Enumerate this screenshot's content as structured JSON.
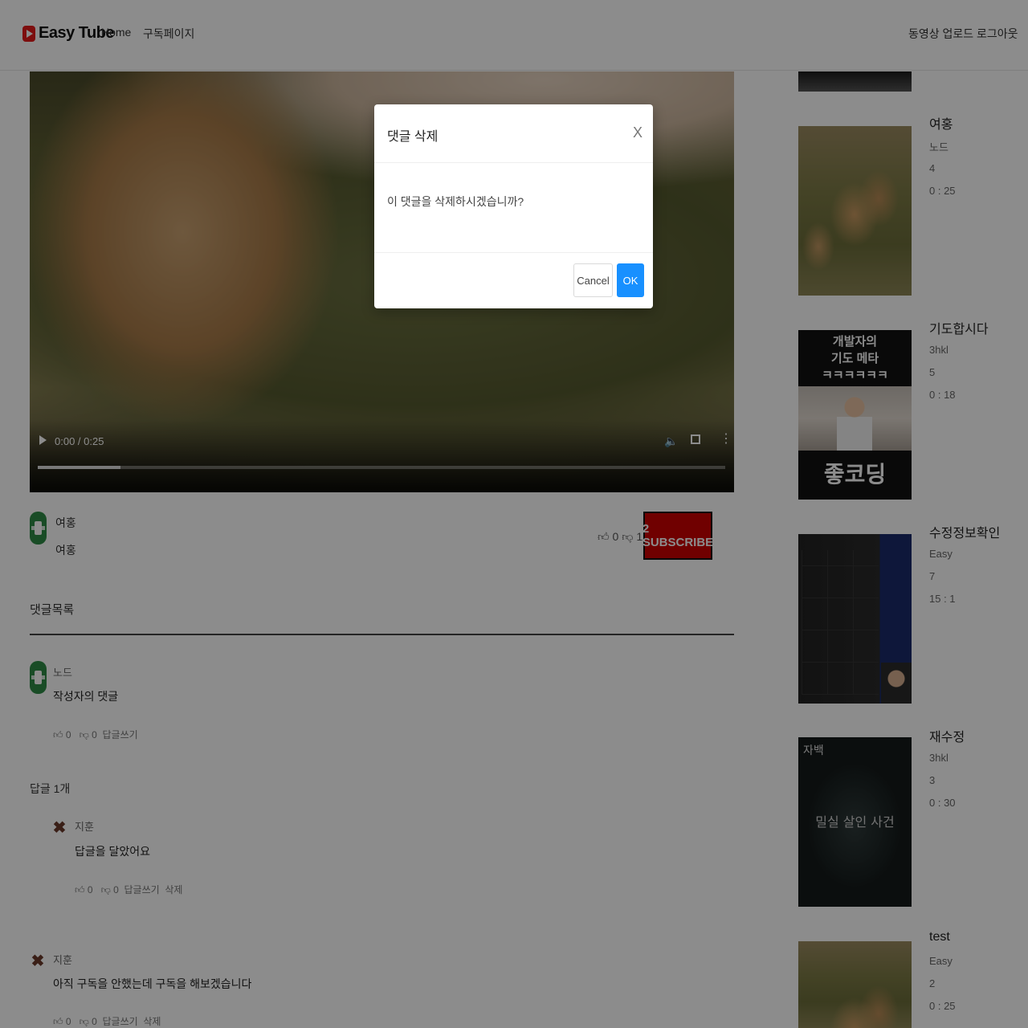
{
  "header": {
    "logo_text": "Easy Tube",
    "nav": {
      "home": "Home",
      "subscriptions": "구독페이지",
      "upload": "동영상 업로드",
      "logout": "로그아웃"
    }
  },
  "player": {
    "time": "0:00 / 0:25",
    "progress_fraction": 0.12
  },
  "video_info": {
    "owner": "여홍",
    "description": "여홍",
    "likes": "0",
    "dislikes": "1",
    "subscribe_label": "2 SUBSCRIBE"
  },
  "comments": {
    "title": "댓글목록",
    "items": [
      {
        "author": "노드",
        "text": "작성자의 댓글",
        "likes": "0",
        "dislikes": "0",
        "reply": "답글쓰기"
      }
    ],
    "reply_count": "답글 1개",
    "replies": [
      {
        "author": "지훈",
        "text": "답글을 달았어요",
        "likes": "0",
        "dislikes": "0",
        "reply": "답글쓰기",
        "delete": "삭제"
      },
      {
        "author": "지훈",
        "text": "아직 구독을 안했는데 구독을 해보겠습니다",
        "likes": "0",
        "dislikes": "0",
        "reply": "답글쓰기",
        "delete": "삭제"
      }
    ]
  },
  "sidebar": {
    "videos": [
      {
        "title": "여홍",
        "author": "노드",
        "views": "4",
        "duration": "0 : 25"
      },
      {
        "title": "기도합시다",
        "author": "3hkl",
        "views": "5",
        "duration": "0 : 18",
        "thumb_title": "개발자의\n기도 메타\nㅋㅋㅋㅋㅋㅋ",
        "thumb_big": "좋코딩"
      },
      {
        "title": "수정정보확인",
        "author": "Easy",
        "views": "7",
        "duration": "15 : 1"
      },
      {
        "title": "재수정",
        "author": "3hkl",
        "views": "3",
        "duration": "0 : 30",
        "thumb_text": "밀실 살인 사건",
        "thumb_corner": "자백"
      },
      {
        "title": "test",
        "author": "Easy",
        "views": "2",
        "duration": "0 : 25"
      }
    ]
  },
  "modal": {
    "title": "댓글 삭제",
    "close": "X",
    "body": "이 댓글을 삭제하시겠습니까?",
    "cancel": "Cancel",
    "ok": "OK"
  },
  "colors": {
    "subscribe": "#cc0000",
    "primary": "#1890ff",
    "avatar_green": "#2e8b46"
  }
}
